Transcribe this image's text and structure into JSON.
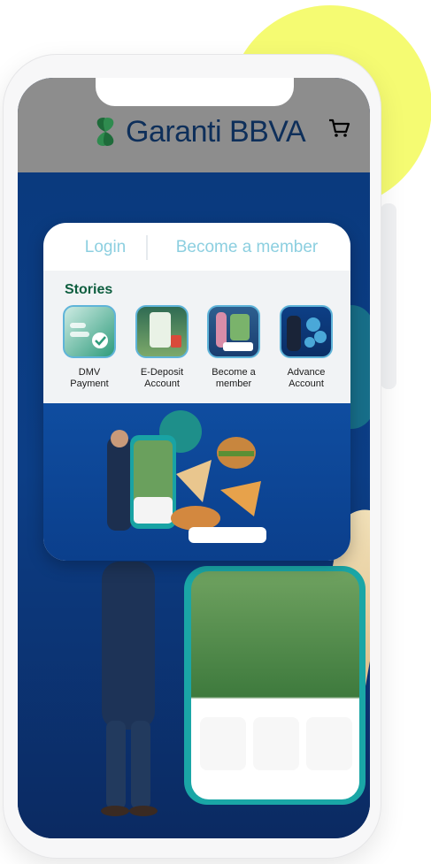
{
  "header": {
    "brand_name": "Garanti BBVA",
    "cart_icon": "cart-icon"
  },
  "auth_tabs": {
    "login_label": "Login",
    "member_label": "Become a member"
  },
  "stories": {
    "title": "Stories",
    "items": [
      {
        "label": "DMV\nPayment"
      },
      {
        "label": "E-Deposit\nAccount"
      },
      {
        "label": "Become a\nmember"
      },
      {
        "label": "Advance\nAccount"
      }
    ]
  },
  "colors": {
    "accent_teal": "#8ccfe0",
    "brand_navy": "#0e2f5a",
    "story_title_green": "#0e5e3f",
    "deco_yellow": "#f5fb72"
  }
}
